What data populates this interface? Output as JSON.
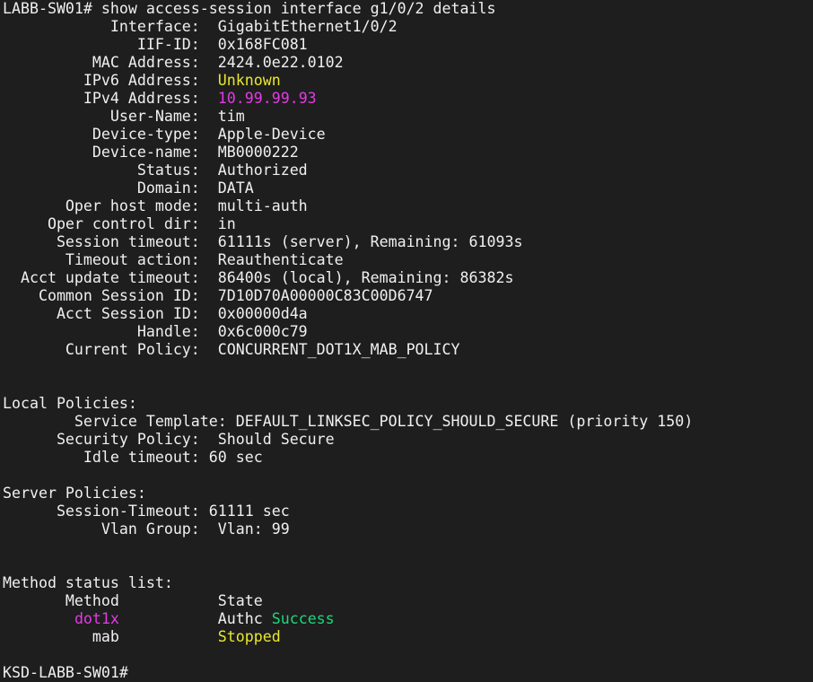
{
  "terminal": {
    "background": "#1e1e1e",
    "colors": {
      "default": "#f0f0f0",
      "magenta": "#e23ae2",
      "yellow": "#e8e82f",
      "green": "#1fd67a"
    },
    "lines": [
      [
        {
          "t": "LABB-SW01# show access-session interface g1/0/2 details"
        }
      ],
      [
        {
          "t": "            Interface:  GigabitEthernet1/0/2"
        }
      ],
      [
        {
          "t": "               IIF-ID:  0x168FC081"
        }
      ],
      [
        {
          "t": "          MAC Address:  2424.0e22.0102"
        }
      ],
      [
        {
          "t": "         IPv6 Address:  "
        },
        {
          "t": "Unknown",
          "c": "yellow"
        }
      ],
      [
        {
          "t": "         IPv4 Address:  "
        },
        {
          "t": "10.99.99.93",
          "c": "magenta"
        }
      ],
      [
        {
          "t": "            User-Name:  tim"
        }
      ],
      [
        {
          "t": "          Device-type:  Apple-Device"
        }
      ],
      [
        {
          "t": "          Device-name:  MB0000222"
        }
      ],
      [
        {
          "t": "               Status:  Authorized"
        }
      ],
      [
        {
          "t": "               Domain:  DATA"
        }
      ],
      [
        {
          "t": "       Oper host mode:  multi-auth"
        }
      ],
      [
        {
          "t": "     Oper control dir:  in"
        }
      ],
      [
        {
          "t": "      Session timeout:  61111s (server), Remaining: 61093s"
        }
      ],
      [
        {
          "t": "       Timeout action:  Reauthenticate"
        }
      ],
      [
        {
          "t": "  Acct update timeout:  86400s (local), Remaining: 86382s"
        }
      ],
      [
        {
          "t": "    Common Session ID:  7D10D70A00000C83C00D6747"
        }
      ],
      [
        {
          "t": "      Acct Session ID:  0x00000d4a"
        }
      ],
      [
        {
          "t": "               Handle:  0x6c000c79"
        }
      ],
      [
        {
          "t": "       Current Policy:  CONCURRENT_DOT1X_MAB_POLICY"
        }
      ],
      [
        {
          "t": ""
        }
      ],
      [
        {
          "t": ""
        }
      ],
      [
        {
          "t": "Local Policies:"
        }
      ],
      [
        {
          "t": "        Service Template: DEFAULT_LINKSEC_POLICY_SHOULD_SECURE (priority 150)"
        }
      ],
      [
        {
          "t": "      Security Policy:  Should Secure"
        }
      ],
      [
        {
          "t": "         Idle timeout: 60 sec"
        }
      ],
      [
        {
          "t": ""
        }
      ],
      [
        {
          "t": "Server Policies:"
        }
      ],
      [
        {
          "t": "      Session-Timeout: 61111 sec"
        }
      ],
      [
        {
          "t": "           Vlan Group:  Vlan: 99"
        }
      ],
      [
        {
          "t": ""
        }
      ],
      [
        {
          "t": ""
        }
      ],
      [
        {
          "t": "Method status list:"
        }
      ],
      [
        {
          "t": "       Method           State"
        }
      ],
      [
        {
          "t": "        "
        },
        {
          "t": "dot1x",
          "c": "magenta"
        },
        {
          "t": "           Authc "
        },
        {
          "t": "Success",
          "c": "green"
        }
      ],
      [
        {
          "t": "          mab           "
        },
        {
          "t": "Stopped",
          "c": "yellow"
        }
      ],
      [
        {
          "t": ""
        }
      ],
      [
        {
          "t": "KSD-LABB-SW01#"
        }
      ]
    ]
  }
}
